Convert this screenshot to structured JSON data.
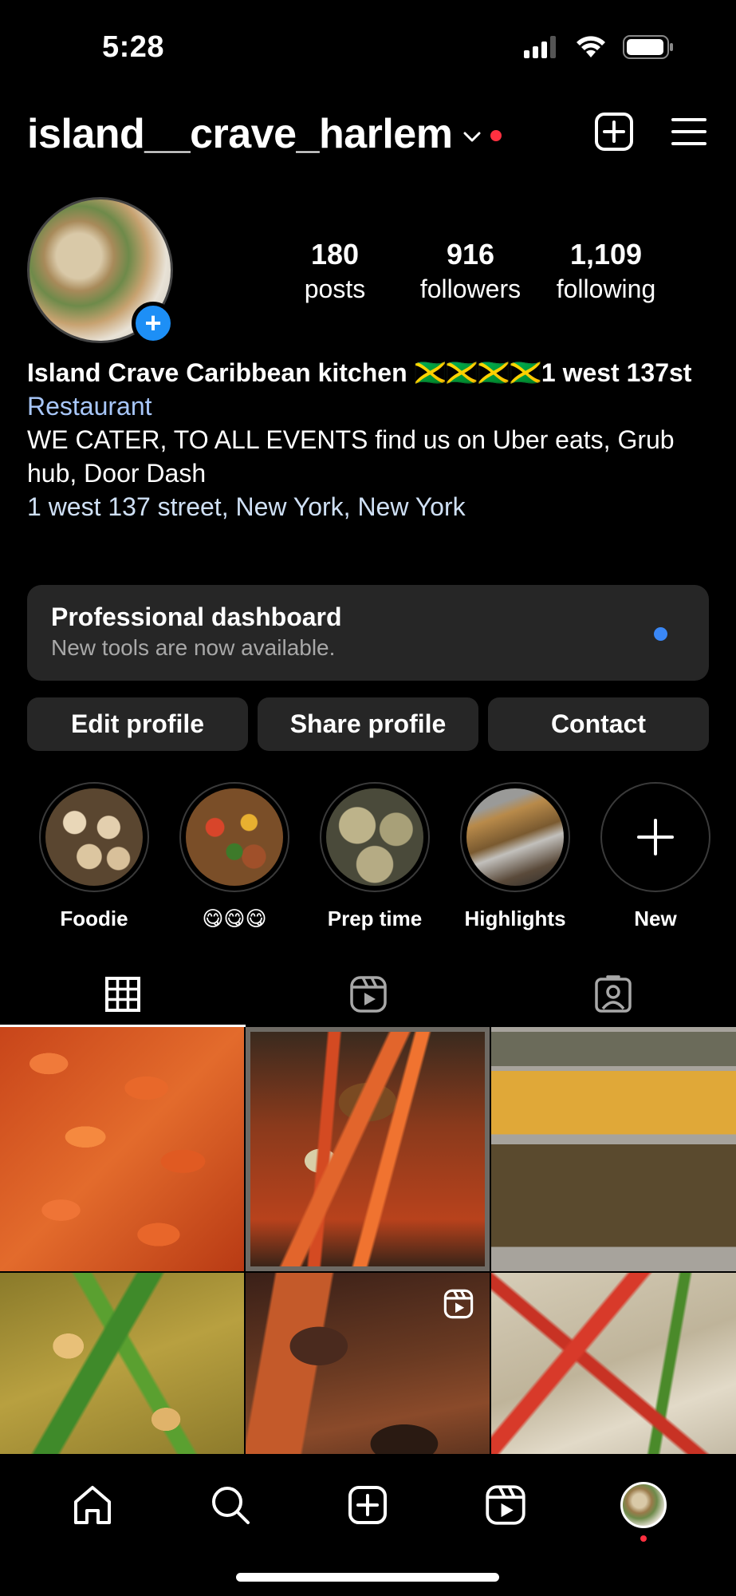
{
  "status_bar": {
    "time": "5:28",
    "icons": [
      "cellular-signal-icon",
      "wifi-icon",
      "battery-icon"
    ]
  },
  "header": {
    "username": "island__crave_harlem",
    "icons": [
      "chevron-down-icon",
      "create-post-icon",
      "menu-icon"
    ],
    "notification_dot_color": "#ff3040"
  },
  "profile": {
    "stats": [
      {
        "value": "180",
        "label": "posts"
      },
      {
        "value": "916",
        "label": "followers"
      },
      {
        "value": "1,109",
        "label": "following"
      }
    ],
    "bio": {
      "name": "Island Crave Caribbean kitchen 🇯🇲🇯🇲🇯🇲🇯🇲1 west 137st",
      "category": "Restaurant",
      "description": "WE CATER, TO ALL EVENTS find us on Uber eats, Grub hub, Door Dash",
      "address": "1 west 137 street, New York, New York"
    }
  },
  "dashboard": {
    "title": "Professional dashboard",
    "subtitle": "New tools are now available.",
    "dot_color": "#3a87f5"
  },
  "buttons": {
    "edit": "Edit profile",
    "share": "Share profile",
    "contact": "Contact"
  },
  "highlights": [
    {
      "label": "Foodie"
    },
    {
      "label": "😋😋😋"
    },
    {
      "label": "Prep time"
    },
    {
      "label": "Highlights"
    },
    {
      "label": "New"
    }
  ],
  "tabs": [
    "grid-icon",
    "reels-icon",
    "tagged-icon"
  ],
  "grid_posts": [
    {
      "subject": "shrimp",
      "is_reel": false
    },
    {
      "subject": "escovitch fish",
      "is_reel": false
    },
    {
      "subject": "rice trays",
      "is_reel": false
    },
    {
      "subject": "curry shrimp",
      "is_reel": false
    },
    {
      "subject": "oxtail",
      "is_reel": true
    },
    {
      "subject": "pasta",
      "is_reel": false
    }
  ],
  "bottom_nav": [
    "home-icon",
    "search-icon",
    "create-icon",
    "reels-icon",
    "profile-avatar"
  ],
  "colors": {
    "background": "#000000",
    "surface": "#262626",
    "accent_blue": "#1d8ff6",
    "link_blue": "#a8c7fa"
  }
}
